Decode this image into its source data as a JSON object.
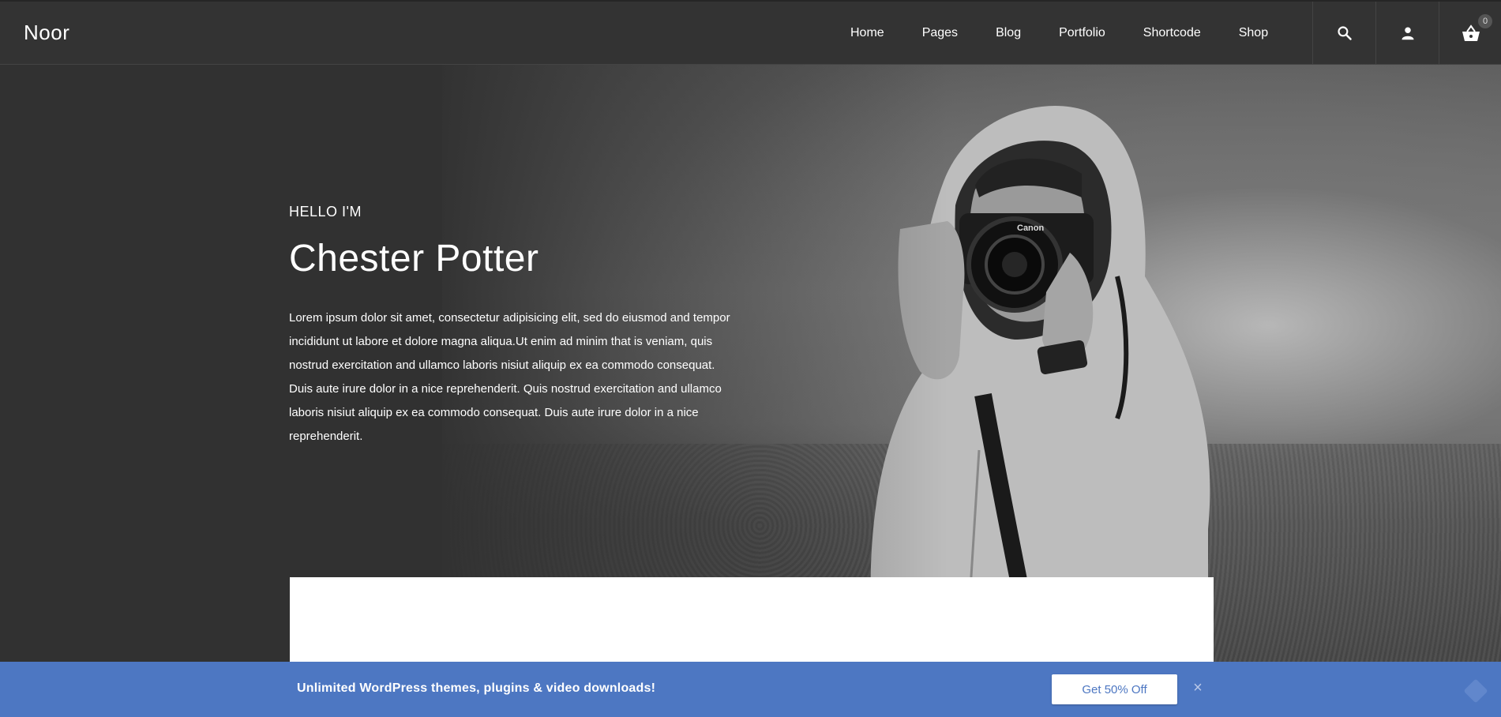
{
  "header": {
    "logo": "Noor",
    "nav": [
      {
        "label": "Home"
      },
      {
        "label": "Pages"
      },
      {
        "label": "Blog"
      },
      {
        "label": "Portfolio"
      },
      {
        "label": "Shortcode"
      },
      {
        "label": "Shop"
      }
    ],
    "cart_count": "0",
    "icons": [
      "search-icon",
      "user-icon",
      "basket-icon"
    ]
  },
  "hero": {
    "kicker": "HELLO I'M",
    "name": "Chester Potter",
    "paragraph": "Lorem ipsum dolor sit amet, consectetur adipisicing elit, sed do eiusmod and tempor incididunt ut labore et dolore magna aliqua.Ut enim ad minim that is veniam, quis nostrud exercitation and ullamco laboris nisiut aliquip ex ea commodo consequat. Duis aute irure dolor in a nice reprehenderit. Quis nostrud exercitation and ullamco laboris nisiut aliquip ex ea commodo consequat. Duis aute irure dolor in a nice reprehenderit.",
    "camera_brand": "Canon"
  },
  "promo": {
    "text": "Unlimited WordPress themes, plugins & video downloads!",
    "button": "Get 50% Off",
    "close": "×"
  },
  "colors": {
    "header_bg": "#333333",
    "hero_bg": "#313131",
    "promo_bg": "#4d77c2",
    "text": "#ffffff"
  }
}
